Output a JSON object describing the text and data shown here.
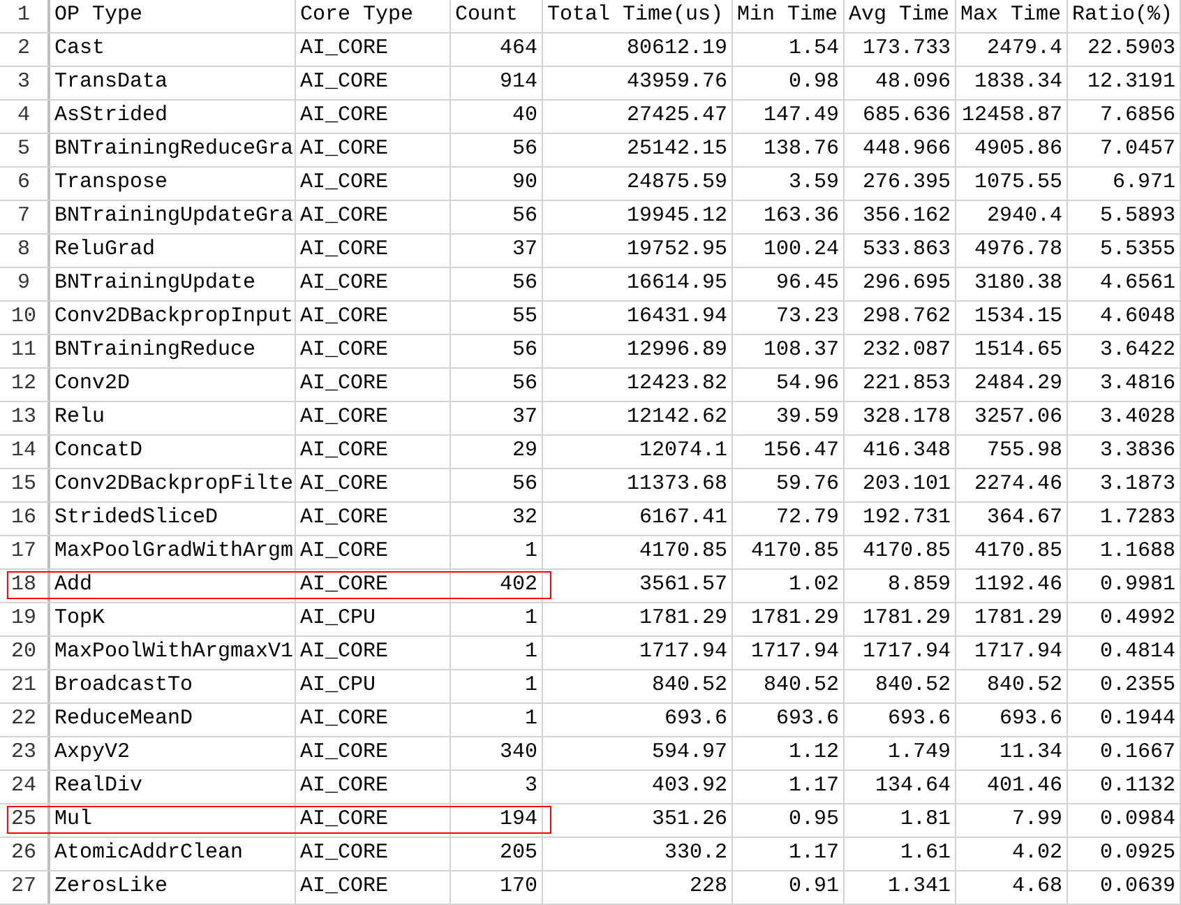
{
  "header": {
    "row_number": "1",
    "columns": [
      "OP Type",
      "Core Type",
      "Count",
      "Total Time(us)",
      "Min Time",
      "Avg Time",
      "Max Time",
      "Ratio(%)"
    ]
  },
  "rows": [
    {
      "row_number": "2",
      "cells": [
        "Cast",
        "AI_CORE",
        "464",
        "80612.19",
        "1.54",
        "173.733",
        "2479.4",
        "22.5903"
      ],
      "highlighted": false
    },
    {
      "row_number": "3",
      "cells": [
        "TransData",
        "AI_CORE",
        "914",
        "43959.76",
        "0.98",
        "48.096",
        "1838.34",
        "12.3191"
      ],
      "highlighted": false
    },
    {
      "row_number": "4",
      "cells": [
        "AsStrided",
        "AI_CORE",
        "40",
        "27425.47",
        "147.49",
        "685.636",
        "12458.87",
        "7.6856"
      ],
      "highlighted": false
    },
    {
      "row_number": "5",
      "cells": [
        "BNTrainingReduceGra",
        "AI_CORE",
        "56",
        "25142.15",
        "138.76",
        "448.966",
        "4905.86",
        "7.0457"
      ],
      "highlighted": false
    },
    {
      "row_number": "6",
      "cells": [
        "Transpose",
        "AI_CORE",
        "90",
        "24875.59",
        "3.59",
        "276.395",
        "1075.55",
        "6.971"
      ],
      "highlighted": false
    },
    {
      "row_number": "7",
      "cells": [
        "BNTrainingUpdateGra",
        "AI_CORE",
        "56",
        "19945.12",
        "163.36",
        "356.162",
        "2940.4",
        "5.5893"
      ],
      "highlighted": false
    },
    {
      "row_number": "8",
      "cells": [
        "ReluGrad",
        "AI_CORE",
        "37",
        "19752.95",
        "100.24",
        "533.863",
        "4976.78",
        "5.5355"
      ],
      "highlighted": false
    },
    {
      "row_number": "9",
      "cells": [
        "BNTrainingUpdate",
        "AI_CORE",
        "56",
        "16614.95",
        "96.45",
        "296.695",
        "3180.38",
        "4.6561"
      ],
      "highlighted": false
    },
    {
      "row_number": "10",
      "cells": [
        "Conv2DBackpropInput",
        "AI_CORE",
        "55",
        "16431.94",
        "73.23",
        "298.762",
        "1534.15",
        "4.6048"
      ],
      "highlighted": false
    },
    {
      "row_number": "11",
      "cells": [
        "BNTrainingReduce",
        "AI_CORE",
        "56",
        "12996.89",
        "108.37",
        "232.087",
        "1514.65",
        "3.6422"
      ],
      "highlighted": false
    },
    {
      "row_number": "12",
      "cells": [
        "Conv2D",
        "AI_CORE",
        "56",
        "12423.82",
        "54.96",
        "221.853",
        "2484.29",
        "3.4816"
      ],
      "highlighted": false
    },
    {
      "row_number": "13",
      "cells": [
        "Relu",
        "AI_CORE",
        "37",
        "12142.62",
        "39.59",
        "328.178",
        "3257.06",
        "3.4028"
      ],
      "highlighted": false
    },
    {
      "row_number": "14",
      "cells": [
        "ConcatD",
        "AI_CORE",
        "29",
        "12074.1",
        "156.47",
        "416.348",
        "755.98",
        "3.3836"
      ],
      "highlighted": false
    },
    {
      "row_number": "15",
      "cells": [
        "Conv2DBackpropFilte",
        "AI_CORE",
        "56",
        "11373.68",
        "59.76",
        "203.101",
        "2274.46",
        "3.1873"
      ],
      "highlighted": false
    },
    {
      "row_number": "16",
      "cells": [
        "StridedSliceD",
        "AI_CORE",
        "32",
        "6167.41",
        "72.79",
        "192.731",
        "364.67",
        "1.7283"
      ],
      "highlighted": false
    },
    {
      "row_number": "17",
      "cells": [
        "MaxPoolGradWithArgm",
        "AI_CORE",
        "1",
        "4170.85",
        "4170.85",
        "4170.85",
        "4170.85",
        "1.1688"
      ],
      "highlighted": false
    },
    {
      "row_number": "18",
      "cells": [
        "Add",
        "AI_CORE",
        "402",
        "3561.57",
        "1.02",
        "8.859",
        "1192.46",
        "0.9981"
      ],
      "highlighted": true
    },
    {
      "row_number": "19",
      "cells": [
        "TopK",
        "AI_CPU",
        "1",
        "1781.29",
        "1781.29",
        "1781.29",
        "1781.29",
        "0.4992"
      ],
      "highlighted": false
    },
    {
      "row_number": "20",
      "cells": [
        "MaxPoolWithArgmaxV1",
        "AI_CORE",
        "1",
        "1717.94",
        "1717.94",
        "1717.94",
        "1717.94",
        "0.4814"
      ],
      "highlighted": false
    },
    {
      "row_number": "21",
      "cells": [
        "BroadcastTo",
        "AI_CPU",
        "1",
        "840.52",
        "840.52",
        "840.52",
        "840.52",
        "0.2355"
      ],
      "highlighted": false
    },
    {
      "row_number": "22",
      "cells": [
        "ReduceMeanD",
        "AI_CORE",
        "1",
        "693.6",
        "693.6",
        "693.6",
        "693.6",
        "0.1944"
      ],
      "highlighted": false
    },
    {
      "row_number": "23",
      "cells": [
        "AxpyV2",
        "AI_CORE",
        "340",
        "594.97",
        "1.12",
        "1.749",
        "11.34",
        "0.1667"
      ],
      "highlighted": false
    },
    {
      "row_number": "24",
      "cells": [
        "RealDiv",
        "AI_CORE",
        "3",
        "403.92",
        "1.17",
        "134.64",
        "401.46",
        "0.1132"
      ],
      "highlighted": false
    },
    {
      "row_number": "25",
      "cells": [
        "Mul",
        "AI_CORE",
        "194",
        "351.26",
        "0.95",
        "1.81",
        "7.99",
        "0.0984"
      ],
      "highlighted": true
    },
    {
      "row_number": "26",
      "cells": [
        "AtomicAddrClean",
        "AI_CORE",
        "205",
        "330.2",
        "1.17",
        "1.61",
        "4.02",
        "0.0925"
      ],
      "highlighted": false
    },
    {
      "row_number": "27",
      "cells": [
        "ZerosLike",
        "AI_CORE",
        "170",
        "228",
        "0.91",
        "1.341",
        "4.68",
        "0.0639"
      ],
      "highlighted": false
    }
  ]
}
